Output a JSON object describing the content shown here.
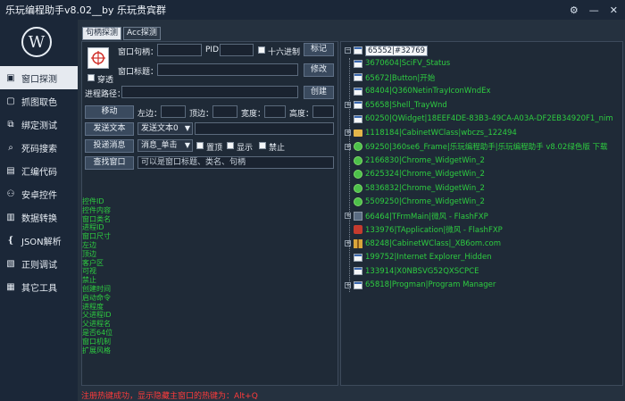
{
  "window": {
    "title": "乐玩编程助手v8.02__by 乐玩贵宾群",
    "settings_glyph": "⚙",
    "minimize_glyph": "—",
    "close_glyph": "✕"
  },
  "logo": {
    "letter": "W"
  },
  "nav": {
    "items": [
      {
        "label": "窗口探测",
        "icon": "window-icon",
        "glyph": "▣",
        "active": true
      },
      {
        "label": "抓图取色",
        "icon": "capture-icon",
        "glyph": "▢"
      },
      {
        "label": "绑定测试",
        "icon": "bind-icon",
        "glyph": "⧉"
      },
      {
        "label": "死码搜索",
        "icon": "search-code-icon",
        "glyph": "⌕"
      },
      {
        "label": "汇编代码",
        "icon": "code-icon",
        "glyph": "▤"
      },
      {
        "label": "安卓控件",
        "icon": "android-icon",
        "glyph": "⚇"
      },
      {
        "label": "数据转换",
        "icon": "convert-icon",
        "glyph": "▥"
      },
      {
        "label": "JSON解析",
        "icon": "json-icon",
        "glyph": "❴"
      },
      {
        "label": "正则调试",
        "icon": "regex-icon",
        "glyph": "▧"
      },
      {
        "label": "其它工具",
        "icon": "tools-icon",
        "glyph": "▦"
      }
    ]
  },
  "tabs": [
    {
      "label": "句柄探测",
      "active": true
    },
    {
      "label": "Acc探测",
      "active": false
    }
  ],
  "form": {
    "handle_label": "窗口句柄：",
    "handle_value": "",
    "pid_label": "PID",
    "pid_value": "",
    "hex_label": "十六进制",
    "mark_button": "标记",
    "transparent_label": "穿透",
    "title_label": "窗口标题：",
    "title_value": "",
    "modify_button": "修改",
    "path_label": "进程路径：",
    "path_value": "",
    "create_button": "创建",
    "move_button": "移动",
    "left_label": "左边：",
    "left_value": "",
    "top_label": "顶边：",
    "top_value": "",
    "width_label": "宽度：",
    "width_value": "",
    "height_label": "高度：",
    "height_value": "",
    "send_text_button": "发送文本",
    "send_text_select": "发送文本0",
    "send_text_value": "",
    "post_msg_button": "投递消息",
    "post_msg_select": "消息_单击",
    "topmost_label": "置顶",
    "show_label": "显示",
    "disable_label": "禁止",
    "find_window_button": "查找窗口",
    "find_window_placeholder": "可以是窗口标题、类名、句柄"
  },
  "info_list": [
    "控件ID",
    "控件内容",
    "窗口类名",
    "进程ID",
    "窗口尺寸",
    "左边",
    "顶边",
    "客户区",
    "可视",
    "禁止",
    "创建时间",
    "启动命令",
    "进程度",
    "父进程ID",
    "父进程名",
    "是否64位",
    "窗口机制",
    "扩展风格"
  ],
  "tree": {
    "root": "65552|#32769",
    "nodes": [
      {
        "text": "3670604|SciFV_Status",
        "icon": "window-icon",
        "expand": false
      },
      {
        "text": "65672|Button|开始",
        "icon": "window-icon",
        "expand": false
      },
      {
        "text": "68404|Q360NetinTrayIconWndEx",
        "icon": "window-icon",
        "expand": false
      },
      {
        "text": "65658|Shell_TrayWnd",
        "icon": "window-icon",
        "expand": true
      },
      {
        "text": "60250|QWidget|18EEF4DE-83B3-49CA-A03A-DF2EB34920F1_nim",
        "icon": "window-icon",
        "expand": false
      },
      {
        "text": "1118184|CabinetWClass|wbczs_122494",
        "icon": "folder-icon",
        "expand": true
      },
      {
        "text": "69250|360se6_Frame|乐玩编程助手|乐玩编程助手 v8.02绿色版 下载",
        "icon": "globe-icon",
        "expand": true
      },
      {
        "text": "2166830|Chrome_WidgetWin_2",
        "icon": "globe-icon",
        "expand": false
      },
      {
        "text": "2625324|Chrome_WidgetWin_2",
        "icon": "globe-icon",
        "expand": false
      },
      {
        "text": "5836832|Chrome_WidgetWin_2",
        "icon": "globe-icon",
        "expand": false
      },
      {
        "text": "5509250|Chrome_WidgetWin_2",
        "icon": "globe-icon",
        "expand": false
      },
      {
        "text": "66464|TFrmMain|微风 - FlashFXP",
        "icon": "app-icon",
        "expand": true
      },
      {
        "text": "133976|TApplication|微风 - FlashFXP",
        "icon": "ftp-icon",
        "expand": false
      },
      {
        "text": "68248|CabinetWClass|_XB6om.com",
        "icon": "zip-icon",
        "expand": true
      },
      {
        "text": "199752|Internet Explorer_Hidden",
        "icon": "window-icon",
        "expand": false
      },
      {
        "text": "133914|X0NBSVG52QXSCPCE",
        "icon": "window-icon",
        "expand": false
      },
      {
        "text": "65818|Progman|Program Manager",
        "icon": "window-icon",
        "expand": true
      }
    ]
  },
  "status": {
    "text": "注册热键成功，显示隐藏主窗口的热键为：Alt+Q"
  },
  "colors": {
    "accent_green": "#2ecc40",
    "status_red": "#ff3b3b",
    "bg_dark": "#1b2738"
  }
}
